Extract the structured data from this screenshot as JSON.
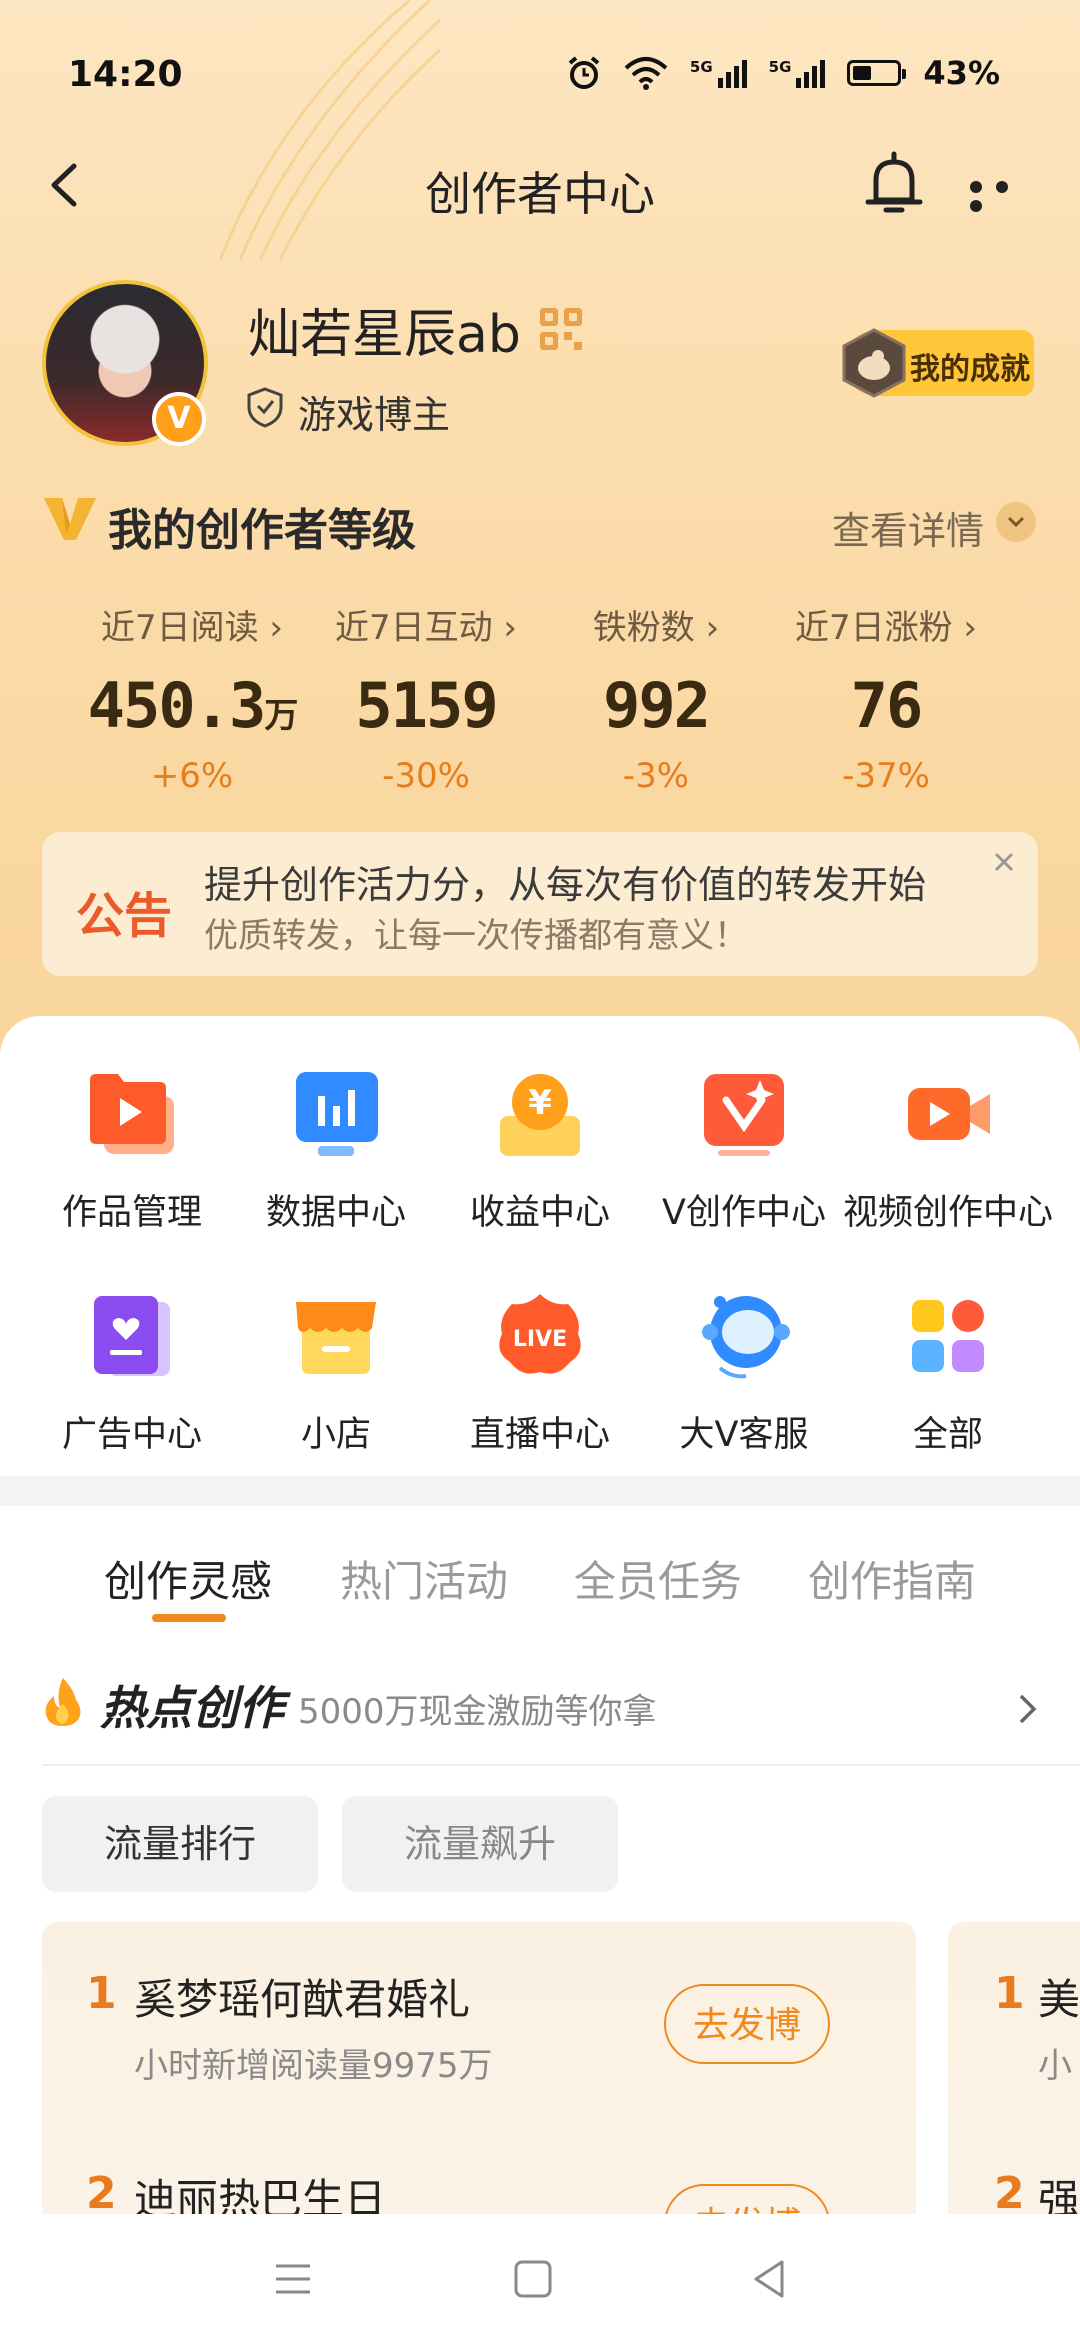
{
  "status_bar": {
    "time": "14:20",
    "signal_label_1": "5G",
    "signal_label_2": "5G",
    "battery": "43%"
  },
  "header": {
    "title": "创作者中心"
  },
  "profile": {
    "name": "灿若星辰ab",
    "role": "游戏博主",
    "verified_badge": "V",
    "achievement": "我的成就"
  },
  "level": {
    "title": "我的创作者等级",
    "detail_link": "查看详情"
  },
  "stats": [
    {
      "label": "近7日阅读",
      "value": "450.3",
      "unit": "万",
      "delta": "+6%"
    },
    {
      "label": "近7日互动",
      "value": "5159",
      "unit": "",
      "delta": "-30%"
    },
    {
      "label": "铁粉数",
      "value": "992",
      "unit": "",
      "delta": "-3%"
    },
    {
      "label": "近7日涨粉",
      "value": "76",
      "unit": "",
      "delta": "-37%"
    }
  ],
  "notice": {
    "tag": "公告",
    "title": "提升创作活力分，从每次有价值的转发开始",
    "subtitle": "优质转发，让每一次传播都有意义！"
  },
  "menu": [
    {
      "label": "作品管理",
      "icon": "works-icon"
    },
    {
      "label": "数据中心",
      "icon": "data-icon"
    },
    {
      "label": "收益中心",
      "icon": "income-icon"
    },
    {
      "label": "V创作中心",
      "icon": "v-create-icon"
    },
    {
      "label": "视频创作中心",
      "icon": "video-icon"
    },
    {
      "label": "广告中心",
      "icon": "ad-icon"
    },
    {
      "label": "小店",
      "icon": "shop-icon"
    },
    {
      "label": "直播中心",
      "icon": "live-icon"
    },
    {
      "label": "大V客服",
      "icon": "support-icon"
    },
    {
      "label": "全部",
      "icon": "all-icon"
    }
  ],
  "tabs": [
    "创作灵感",
    "热门活动",
    "全员任务",
    "创作指南"
  ],
  "hot": {
    "title": "热点创作",
    "subtitle": "5000万现金激励等你拿"
  },
  "chips": [
    "流量排行",
    "流量飙升"
  ],
  "ranking": [
    {
      "rank": "1",
      "title": "奚梦瑶何猷君婚礼",
      "sub": "小时新增阅读量9975万",
      "button": "去发博"
    },
    {
      "rank": "2",
      "title": "迪丽热巴生日",
      "button": "去发博"
    }
  ],
  "ranking_peek": [
    {
      "rank": "1",
      "title": "美",
      "sub": "小"
    },
    {
      "rank": "2",
      "title": "强"
    }
  ],
  "live_badge_text": "LIVE",
  "income_symbol": "¥"
}
